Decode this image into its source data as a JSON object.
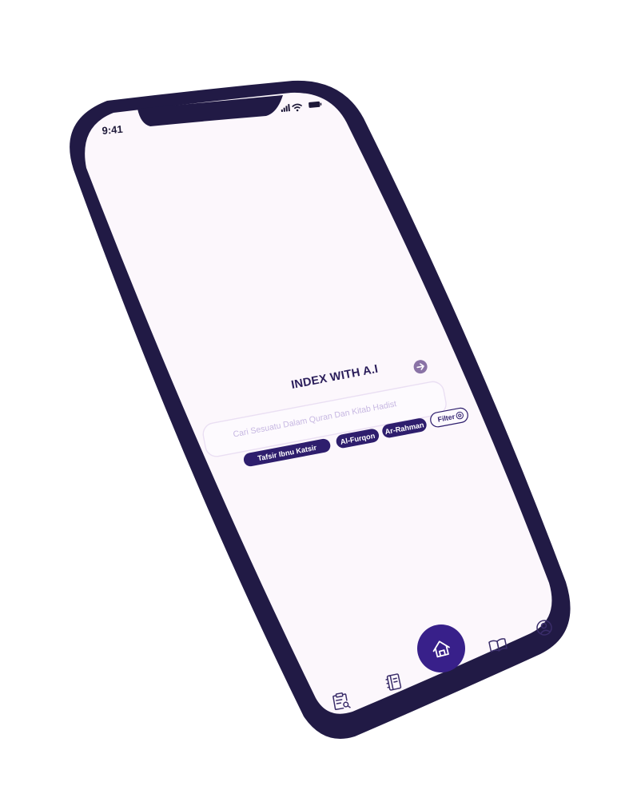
{
  "status_bar": {
    "time": "9:41",
    "signal_icon": "cellular-signal-icon",
    "wifi_icon": "wifi-icon",
    "battery_icon": "battery-icon"
  },
  "main": {
    "title": "INDEX WITH A.I",
    "search": {
      "placeholder": "Cari Sesuatu Dalam Quran Dan Kitab Hadist",
      "submit_icon": "arrow-right-icon"
    },
    "chips": [
      {
        "label": "Tafsir Ibnu Katsir"
      },
      {
        "label": "Al-Furqon"
      },
      {
        "label": "Ar-Rahman"
      }
    ],
    "filter": {
      "label": "Filter",
      "icon": "filter-target-icon"
    }
  },
  "bottom_nav": {
    "items": [
      {
        "icon": "clipboard-search-icon"
      },
      {
        "icon": "notebook-icon"
      },
      {
        "icon": "home-icon",
        "active": true
      },
      {
        "icon": "open-book-icon"
      },
      {
        "icon": "user-circle-icon"
      }
    ]
  },
  "colors": {
    "frame": "#211a45",
    "screen": "#fcf7fc",
    "accent": "#38208a",
    "chip": "#2e1e6d",
    "placeholder": "#c7b8e2"
  }
}
